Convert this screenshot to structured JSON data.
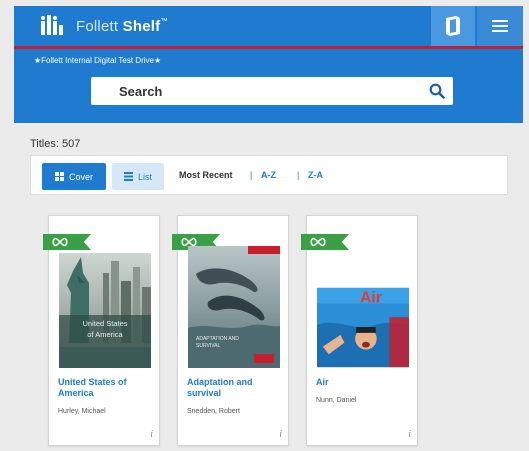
{
  "header": {
    "brand_light": "Follett",
    "brand_bold": "Shelf",
    "trademark": "™",
    "icons": {
      "logo": "follett-logo-icon",
      "account": "account-icon",
      "menu": "hamburger-menu-icon"
    }
  },
  "library": {
    "name": "★Follett Internal Digital Test Drive★"
  },
  "search": {
    "placeholder": "Search",
    "value": ""
  },
  "titles": {
    "label": "Titles: 507"
  },
  "view": {
    "cover_label": "Cover",
    "list_label": "List"
  },
  "sort": {
    "recent": "Most Recent",
    "az": "A-Z",
    "za": "Z-A",
    "separator": "|"
  },
  "books": [
    {
      "title": "United States of America",
      "author": "Hurley, Michael",
      "badge": "∞",
      "info": "i"
    },
    {
      "title": "Adaptation and survival",
      "author": "Snedden, Robert",
      "badge": "∞",
      "info": "i"
    },
    {
      "title": "Air",
      "author": "Nunn, Daniel",
      "badge": "∞",
      "info": "i"
    }
  ],
  "colors": {
    "primary": "#1e7bd0",
    "accent_red": "#c81f2c",
    "badge_green": "#3aa046"
  }
}
